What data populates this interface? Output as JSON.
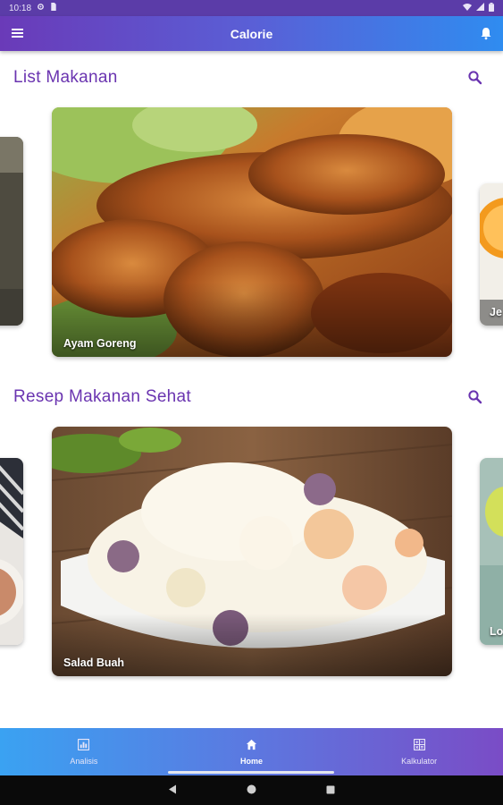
{
  "status_bar": {
    "time": "10:18"
  },
  "app_bar": {
    "title": "Calorie"
  },
  "sections": [
    {
      "title": "List Makanan",
      "cards": [
        {
          "caption": ""
        },
        {
          "caption": "Ayam Goreng"
        },
        {
          "caption": "Je"
        }
      ]
    },
    {
      "title": "Resep Makanan Sehat",
      "cards": [
        {
          "caption": ""
        },
        {
          "caption": "Salad Buah"
        },
        {
          "caption": "Lo"
        }
      ]
    }
  ],
  "bottom_nav": {
    "items": [
      {
        "label": "Analisis",
        "icon": "chart-icon",
        "active": false
      },
      {
        "label": "Home",
        "icon": "home-icon",
        "active": true
      },
      {
        "label": "Kalkulator",
        "icon": "calculator-icon",
        "active": false
      }
    ]
  },
  "colors": {
    "accent": "#6a34b0",
    "app_bar_start": "#6a3ab8",
    "app_bar_end": "#2f8cf0",
    "nav_start": "#3aa2f2",
    "nav_end": "#7a4cc6"
  }
}
